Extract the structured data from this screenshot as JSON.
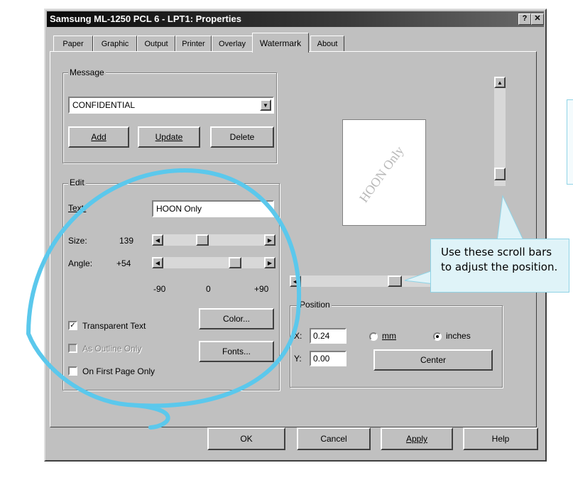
{
  "window": {
    "title": "Samsung ML-1250 PCL 6 - LPT1: Properties",
    "help_btn": "?",
    "close_btn": "✕"
  },
  "tabs": [
    "Paper",
    "Graphic",
    "Output",
    "Printer",
    "Overlay",
    "Watermark",
    "About"
  ],
  "active_tab": "Watermark",
  "message": {
    "group_label": "Message",
    "selected": "CONFIDENTIAL",
    "add_label": "Add",
    "update_label": "Update",
    "delete_label": "Delete"
  },
  "edit": {
    "group_label": "Edit",
    "text_label": "Text:",
    "text_value": "HOON Only",
    "size_label": "Size:",
    "size_value": "139",
    "angle_label": "Angle:",
    "angle_value": "+54",
    "scale_min": "-90",
    "scale_mid": "0",
    "scale_max": "+90",
    "transparent_label": "Transparent Text",
    "transparent_checked": true,
    "outline_label": "As Outline Only",
    "outline_checked": false,
    "firstpage_label": "On First Page Only",
    "firstpage_checked": false,
    "color_label": "Color...",
    "fonts_label": "Fonts..."
  },
  "preview": {
    "watermark_text": "HOON Only"
  },
  "position": {
    "group_label": "Position",
    "x_label": "X:",
    "x_value": "0.24",
    "y_label": "Y:",
    "y_value": "0.00",
    "mm_label": "mm",
    "inches_label": "inches",
    "unit_selected": "inches",
    "center_label": "Center"
  },
  "footer": {
    "ok_label": "OK",
    "cancel_label": "Cancel",
    "apply_label": "Apply",
    "help_label": "Help"
  },
  "callout": {
    "text": "Use these scroll bars to adjust the position."
  },
  "colors": {
    "dialog_face": "#c0c0c0",
    "annotation_stroke": "#5bc8ec",
    "callout_fill": "#dff3f8"
  }
}
